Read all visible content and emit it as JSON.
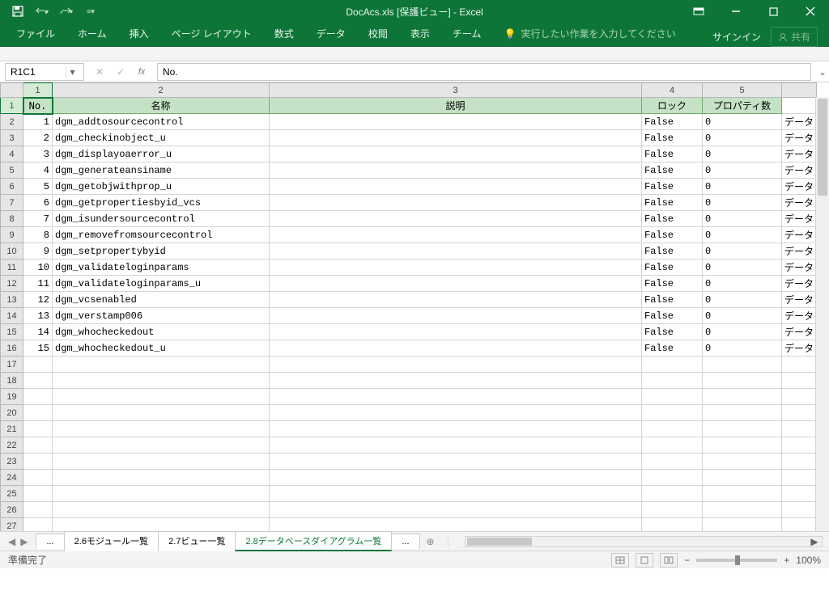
{
  "title": "DocAcs.xls [保護ビュー] - Excel",
  "qat": {
    "save": "save",
    "undo": "undo",
    "redo": "redo"
  },
  "ribbon": {
    "tabs": [
      "ファイル",
      "ホーム",
      "挿入",
      "ページ レイアウト",
      "数式",
      "データ",
      "校閲",
      "表示",
      "チーム"
    ],
    "tellme_icon": "lightbulb",
    "tellme": "実行したい作業を入力してください",
    "signin": "サインイン",
    "share": "共有"
  },
  "namebox": "R1C1",
  "formula": "No.",
  "colnums": [
    "1",
    "2",
    "3",
    "4",
    "5"
  ],
  "headers": {
    "no": "No.",
    "name": "名称",
    "desc": "説明",
    "lock": "ロック",
    "props": "プロパティ数"
  },
  "colwidths": {
    "no": 36,
    "name": 268,
    "desc": 460,
    "lock": 75,
    "props": 98,
    "extra": 40
  },
  "rows": [
    {
      "n": "1",
      "name": "dgm_addtosourcecontrol",
      "lock": "False",
      "p": "0",
      "x": "データ"
    },
    {
      "n": "2",
      "name": "dgm_checkinobject_u",
      "lock": "False",
      "p": "0",
      "x": "データ"
    },
    {
      "n": "3",
      "name": "dgm_displayoaerror_u",
      "lock": "False",
      "p": "0",
      "x": "データ"
    },
    {
      "n": "4",
      "name": "dgm_generateansiname",
      "lock": "False",
      "p": "0",
      "x": "データ"
    },
    {
      "n": "5",
      "name": "dgm_getobjwithprop_u",
      "lock": "False",
      "p": "0",
      "x": "データ"
    },
    {
      "n": "6",
      "name": "dgm_getpropertiesbyid_vcs",
      "lock": "False",
      "p": "0",
      "x": "データ"
    },
    {
      "n": "7",
      "name": "dgm_isundersourcecontrol",
      "lock": "False",
      "p": "0",
      "x": "データ"
    },
    {
      "n": "8",
      "name": "dgm_removefromsourcecontrol",
      "lock": "False",
      "p": "0",
      "x": "データ"
    },
    {
      "n": "9",
      "name": "dgm_setpropertybyid",
      "lock": "False",
      "p": "0",
      "x": "データ"
    },
    {
      "n": "10",
      "name": "dgm_validateloginparams",
      "lock": "False",
      "p": "0",
      "x": "データ"
    },
    {
      "n": "11",
      "name": "dgm_validateloginparams_u",
      "lock": "False",
      "p": "0",
      "x": "データ"
    },
    {
      "n": "12",
      "name": "dgm_vcsenabled",
      "lock": "False",
      "p": "0",
      "x": "データ"
    },
    {
      "n": "13",
      "name": "dgm_verstamp006",
      "lock": "False",
      "p": "0",
      "x": "データ"
    },
    {
      "n": "14",
      "name": "dgm_whocheckedout",
      "lock": "False",
      "p": "0",
      "x": "データ"
    },
    {
      "n": "15",
      "name": "dgm_whocheckedout_u",
      "lock": "False",
      "p": "0",
      "x": "データ"
    }
  ],
  "emptyrows": [
    "17",
    "18",
    "19",
    "20",
    "21",
    "22",
    "23",
    "24",
    "25",
    "26",
    "27"
  ],
  "sheets": {
    "dots": "...",
    "tabs": [
      "2.6モジュール一覧",
      "2.7ビュー一覧",
      "2.8データベースダイアグラム一覧"
    ],
    "active": 2,
    "more": "..."
  },
  "status": {
    "ready": "準備完了",
    "zoom": "100%"
  }
}
